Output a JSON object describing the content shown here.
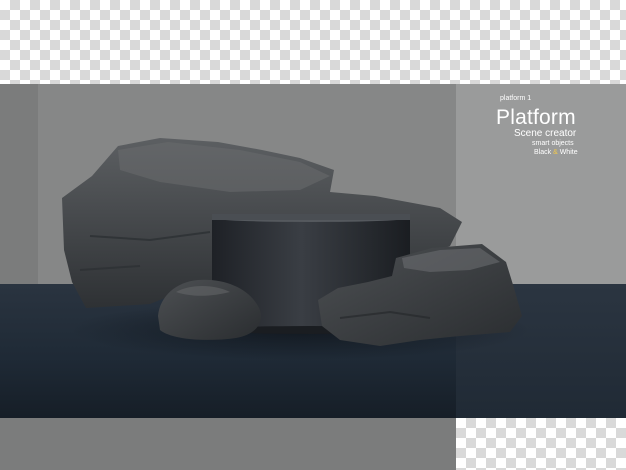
{
  "label": {
    "small": "platform 1",
    "title": "Platform",
    "subtitle": "Scene creator",
    "line3": "smart objects",
    "line4_a": "Black",
    "line4_amp": "&",
    "line4_b": "White"
  },
  "colors": {
    "stage_bg": "#7b7c7c",
    "side_bg": "#9a9b9b",
    "floor": "#1f2a36",
    "rock": "#3f4347",
    "podium": "#2b2e33",
    "accent_amp": "#f2c94c"
  }
}
